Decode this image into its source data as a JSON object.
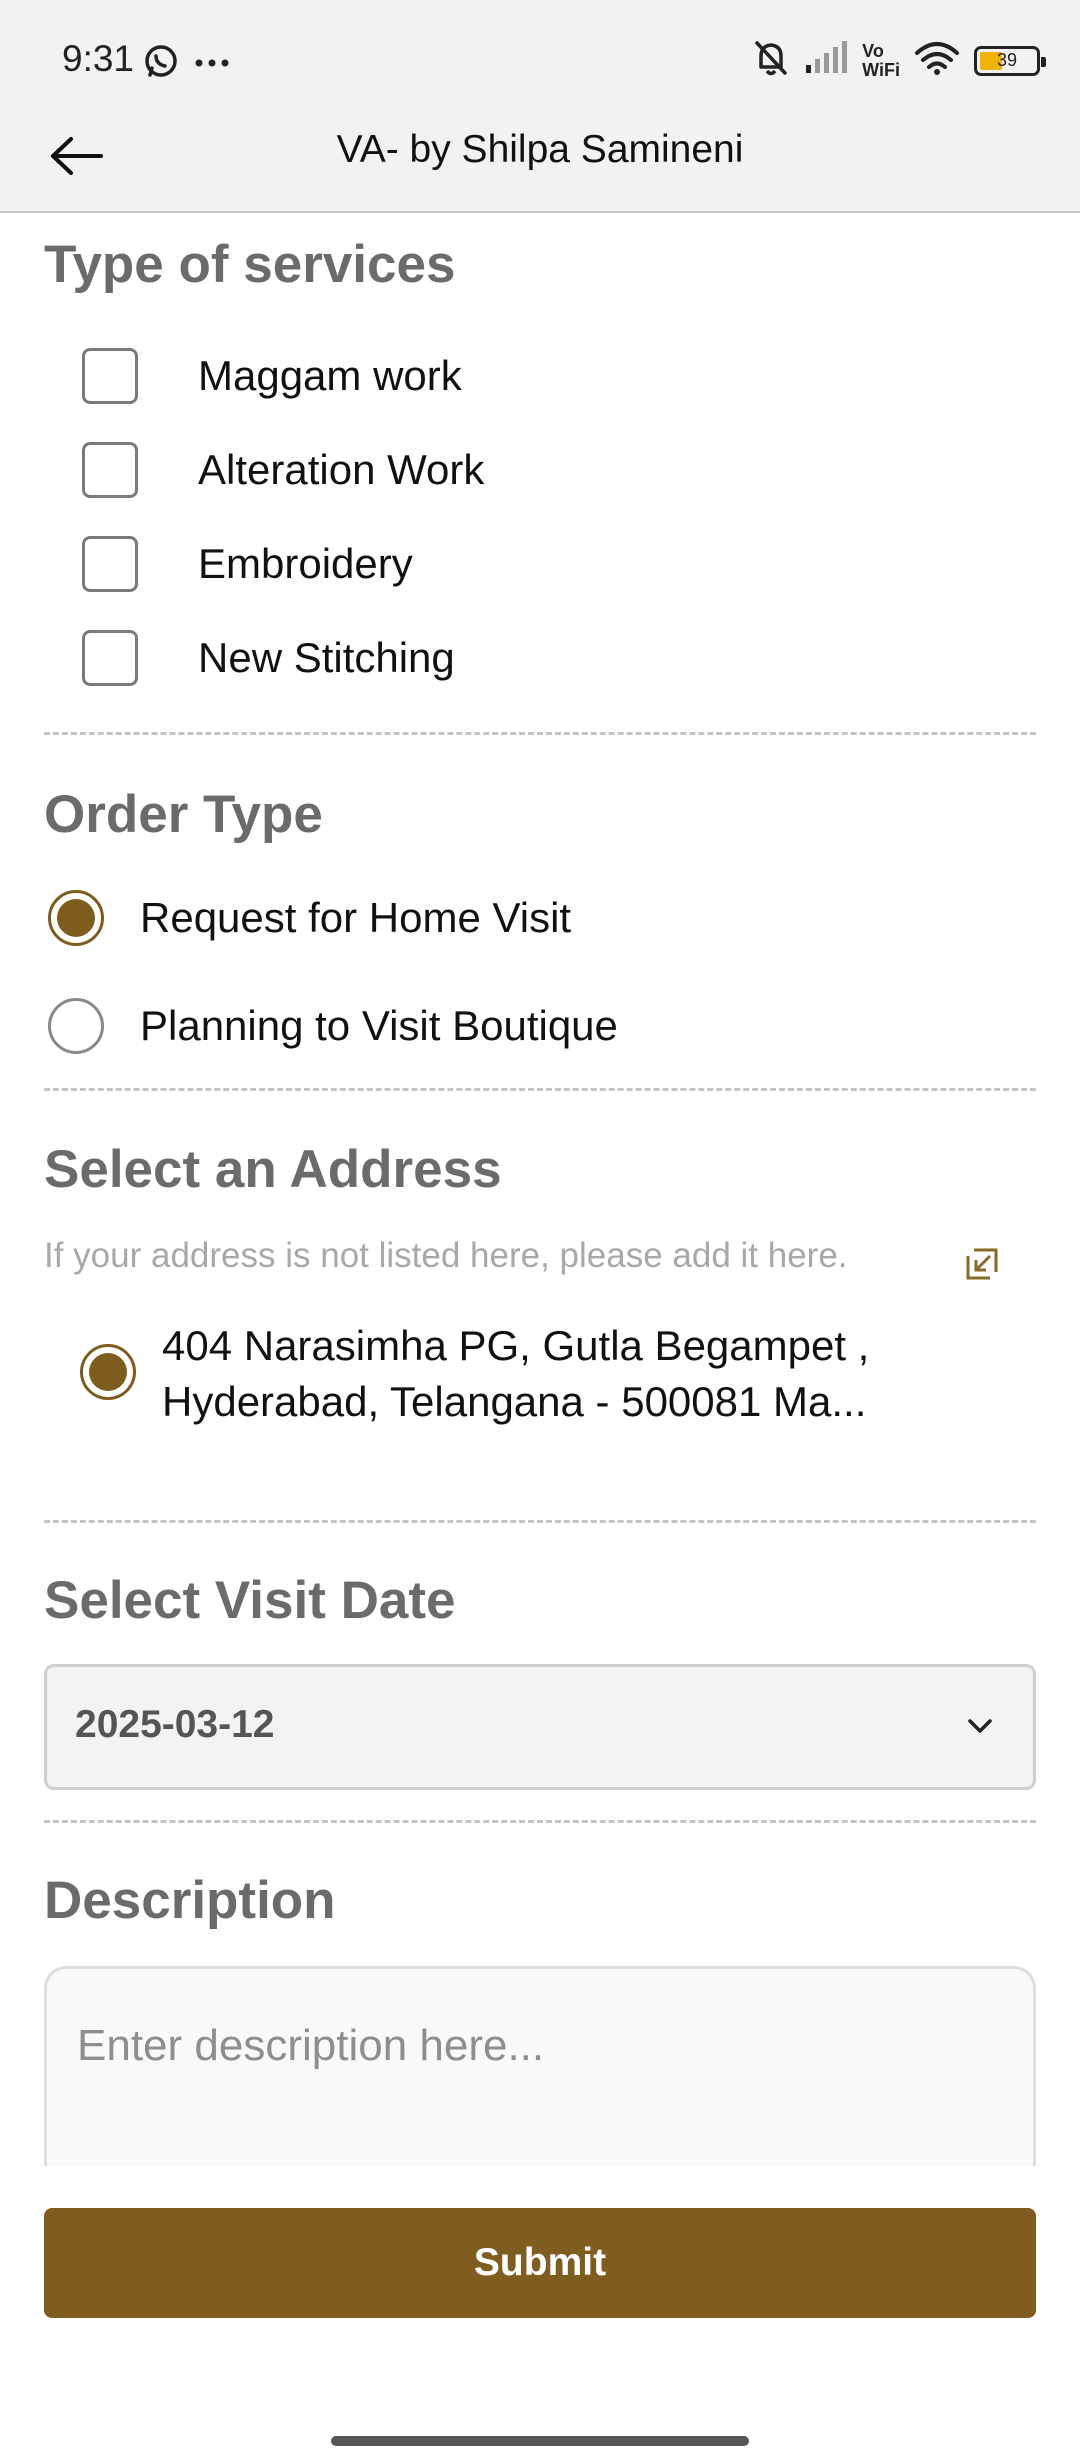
{
  "status_bar": {
    "time": "9:31",
    "icons": [
      "whatsapp-icon",
      "more-dots-icon",
      "bell-off-icon",
      "signal-icon",
      "vowifi-icon",
      "wifi-icon",
      "battery-icon"
    ],
    "vowifi_top": "Vo",
    "vowifi_bottom": "WiFi",
    "battery_level": "39"
  },
  "app_bar": {
    "title": "VA- by Shilpa Samineni",
    "back_icon": "arrow-left-icon"
  },
  "services": {
    "title": "Type of services",
    "options": [
      {
        "label": "Maggam work",
        "checked": false
      },
      {
        "label": "Alteration Work",
        "checked": false
      },
      {
        "label": "Embroidery",
        "checked": false
      },
      {
        "label": "New Stitching",
        "checked": false
      }
    ]
  },
  "order_type": {
    "title": "Order Type",
    "options": [
      {
        "label": "Request for Home Visit",
        "selected": true
      },
      {
        "label": "Planning to Visit Boutique",
        "selected": false
      }
    ]
  },
  "address": {
    "title": "Select an Address",
    "hint": "If your address is not listed here, please add it here.",
    "hint_icon": "open-external-icon",
    "line1": "404 Narasimha PG, Gutla Begampet ,",
    "line2": "Hyderabad, Telangana - 500081 Ma...",
    "selected": true
  },
  "visit_date": {
    "title": "Select Visit Date",
    "value": "2025-03-12",
    "icon": "chevron-down-icon"
  },
  "description": {
    "title": "Description",
    "placeholder": "Enter description here..."
  },
  "submit": {
    "label": "Submit"
  },
  "colors": {
    "accent": "#7e5d1e",
    "section_title": "#6b6b6b",
    "topbar_bg": "#f2f2f2"
  }
}
